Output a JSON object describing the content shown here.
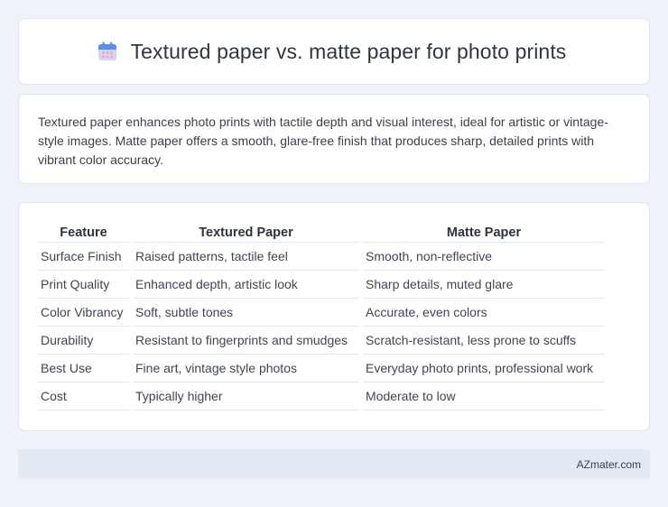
{
  "header": {
    "title": "Textured paper vs. matte paper for photo prints",
    "icon": "calendar-icon",
    "icon_colors": {
      "top": "#5b8def",
      "body": "#d9d2f5",
      "dots": "#f29fc0"
    }
  },
  "summary": {
    "text": "Textured paper enhances photo prints with tactile depth and visual interest, ideal for artistic or vintage-style images. Matte paper offers a smooth, glare-free finish that produces sharp, detailed prints with vibrant color accuracy."
  },
  "table": {
    "headers": [
      "Feature",
      "Textured Paper",
      "Matte Paper"
    ],
    "rows": [
      [
        "Surface Finish",
        "Raised patterns, tactile feel",
        "Smooth, non-reflective"
      ],
      [
        "Print Quality",
        "Enhanced depth, artistic look",
        "Sharp details, muted glare"
      ],
      [
        "Color Vibrancy",
        "Soft, subtle tones",
        "Accurate, even colors"
      ],
      [
        "Durability",
        "Resistant to fingerprints and smudges",
        "Scratch-resistant, less prone to scuffs"
      ],
      [
        "Best Use",
        "Fine art, vintage style photos",
        "Everyday photo prints, professional work"
      ],
      [
        "Cost",
        "Typically higher",
        "Moderate to low"
      ]
    ]
  },
  "footer": {
    "text": "AZmater.com"
  }
}
